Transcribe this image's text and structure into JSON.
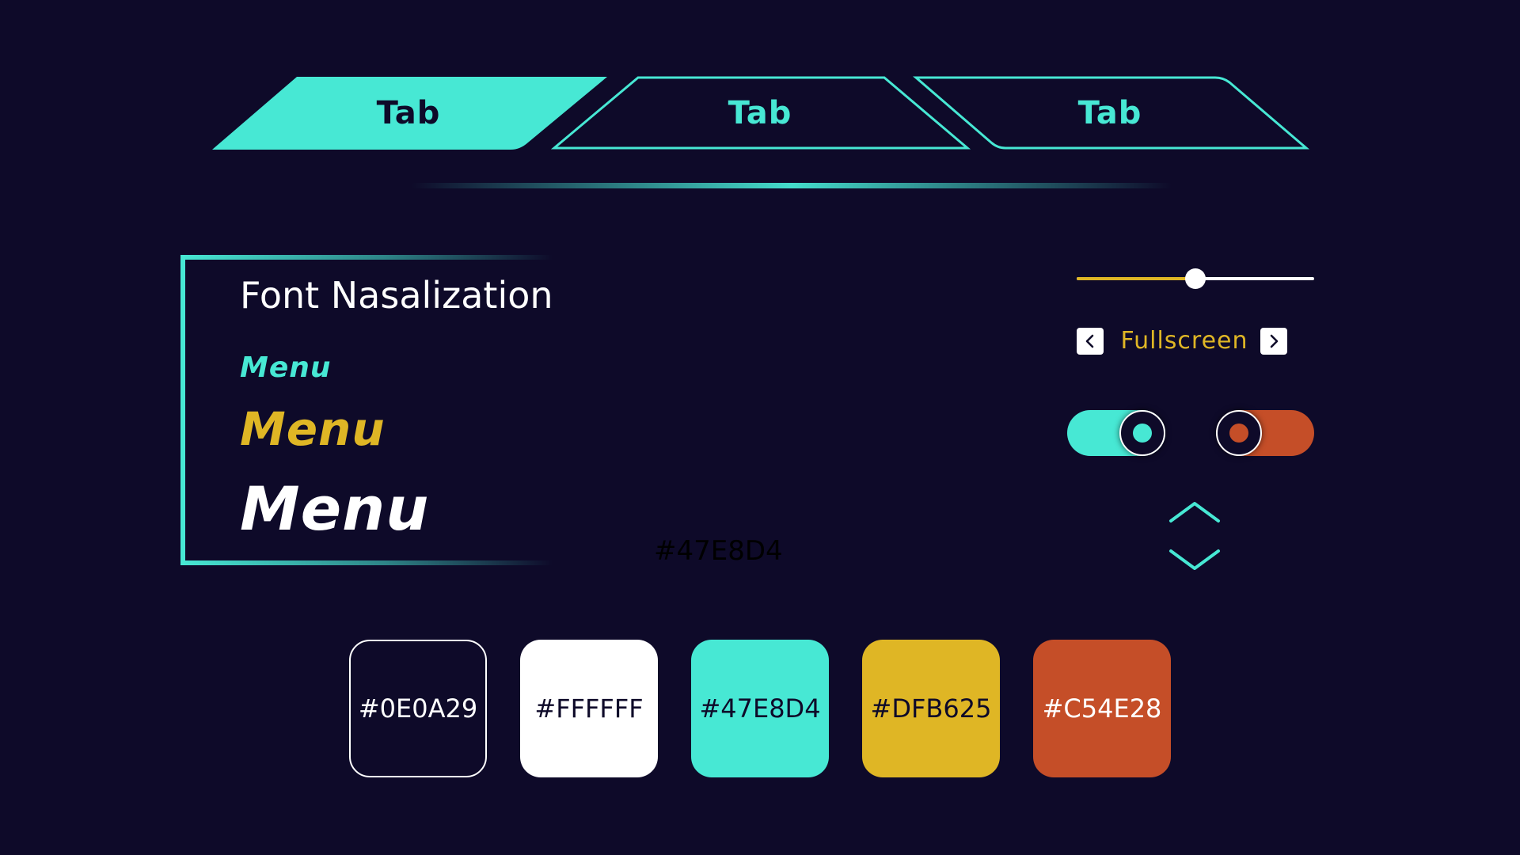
{
  "colors": {
    "background": "#0E0A29",
    "white": "#FFFFFF",
    "accent": "#47E8D4",
    "gold": "#DFB625",
    "orange": "#C54E28"
  },
  "tabs": [
    {
      "label": "Tab",
      "active": true
    },
    {
      "label": "Tab",
      "active": false
    },
    {
      "label": "Tab",
      "active": false
    }
  ],
  "font_panel": {
    "title": "Font Nasalization",
    "samples": [
      {
        "text": "Menu",
        "color": "#47E8D4"
      },
      {
        "text": "Menu",
        "color": "#DFB625"
      },
      {
        "text": "Menu",
        "color": "#FFFFFF"
      }
    ]
  },
  "floating_label": "#47E8D4",
  "slider": {
    "value": 0.5,
    "fill_color": "#DFB625",
    "track_color": "#FFFFFF"
  },
  "fullscreen_selector": {
    "label": "Fullscreen",
    "color": "#DFB625",
    "prev_icon": "chevron-left-icon",
    "next_icon": "chevron-right-icon"
  },
  "toggles": [
    {
      "state": "on",
      "color": "#47E8D4"
    },
    {
      "state": "off",
      "color": "#C54E28"
    }
  ],
  "steppers": {
    "up_icon": "chevron-up-icon",
    "down_icon": "chevron-down-icon",
    "color": "#47E8D4"
  },
  "swatches": [
    {
      "label": "#0E0A29",
      "fill": "#0E0A29",
      "text_color": "#FFFFFF"
    },
    {
      "label": "#FFFFFF",
      "fill": "#FFFFFF",
      "text_color": "#0E0A29"
    },
    {
      "label": "#47E8D4",
      "fill": "#47E8D4",
      "text_color": "#0E0A29"
    },
    {
      "label": "#DFB625",
      "fill": "#DFB625",
      "text_color": "#0E0A29"
    },
    {
      "label": "#C54E28",
      "fill": "#C54E28",
      "text_color": "#FFFFFF"
    }
  ]
}
